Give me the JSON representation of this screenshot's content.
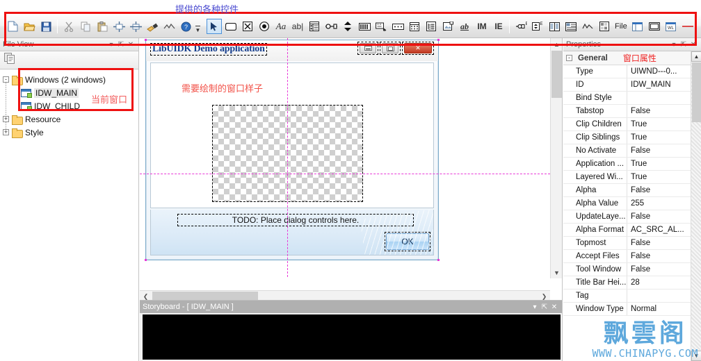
{
  "annotations": {
    "toolbar_note": "提供的各种控件",
    "window_note": "当前窗口",
    "canvas_note": "需要绘制的窗口样子",
    "properties_note": "窗口属性",
    "accent_red": "#ee1111",
    "accent_blue": "#4b4bd0"
  },
  "toolbar": {
    "groups": [
      {
        "name": "standard",
        "items": [
          {
            "icon": "new-file-icon",
            "label": "New"
          },
          {
            "icon": "open-folder-icon",
            "label": "Open"
          },
          {
            "icon": "save-disk-icon",
            "label": "Save"
          },
          {
            "icon": "cut-scissors-icon",
            "label": "Cut"
          },
          {
            "icon": "copy-icon",
            "label": "Copy"
          },
          {
            "icon": "paste-icon",
            "label": "Paste"
          },
          {
            "icon": "align-horizontal-icon",
            "label": "Align Horizontal"
          },
          {
            "icon": "align-vertical-icon",
            "label": "Align Vertical"
          },
          {
            "icon": "brush-icon",
            "label": "Brush"
          },
          {
            "icon": "curve-icon",
            "label": "Curve"
          },
          {
            "icon": "help-icon",
            "label": "Help"
          }
        ]
      },
      {
        "name": "controls",
        "items": [
          {
            "icon": "pointer-arrow-icon",
            "label": "Select",
            "selected": true
          },
          {
            "icon": "button-control-icon",
            "label": "Button"
          },
          {
            "icon": "checkbox-control-icon",
            "label": "Check Box"
          },
          {
            "icon": "radio-control-icon",
            "label": "Radio Button"
          },
          {
            "icon": "static-text-icon",
            "label": "Static Text"
          },
          {
            "icon": "edit-control-icon",
            "label": "Edit"
          },
          {
            "icon": "listview-control-icon",
            "label": "List View"
          },
          {
            "icon": "slider-control-icon",
            "label": "Slider"
          },
          {
            "icon": "spin-control-icon",
            "label": "Spin"
          },
          {
            "icon": "progress-control-icon",
            "label": "Progress"
          },
          {
            "icon": "hotkey-control-icon",
            "label": "Hot Key"
          },
          {
            "icon": "ip-address-icon",
            "label": "IP Address"
          },
          {
            "icon": "calendar-control-icon",
            "label": "Calendar"
          },
          {
            "icon": "treeview-control-icon",
            "label": "Tree View"
          },
          {
            "icon": "picture-control-icon",
            "label": "Picture"
          },
          {
            "icon": "ab-link-icon",
            "label": "ab"
          },
          {
            "icon": "im-icon",
            "label": "IM"
          },
          {
            "icon": "ie-icon",
            "label": "IE"
          },
          {
            "icon": "hotkey-ex-icon",
            "label": "Hot Key Ex"
          },
          {
            "icon": "spin-ex-icon",
            "label": "Spin Ex"
          },
          {
            "icon": "split-pane-icon",
            "label": "Split Pane"
          },
          {
            "icon": "report-list-icon",
            "label": "Report List"
          },
          {
            "icon": "chart-line-icon",
            "label": "Chart"
          },
          {
            "icon": "color-picker-icon",
            "label": "Color Picker"
          },
          {
            "icon": "file-label",
            "label": "File"
          },
          {
            "icon": "layout-left-icon",
            "label": "Layout Left"
          },
          {
            "icon": "panel-icon",
            "label": "Panel"
          },
          {
            "icon": "window-list-icon",
            "label": "Window List"
          },
          {
            "icon": "separator-line-icon",
            "label": "Separator"
          },
          {
            "icon": "text-tool-icon",
            "label": "Text"
          },
          {
            "icon": "window-tool-icon",
            "label": "Window"
          }
        ]
      },
      {
        "name": "extra",
        "items": [
          {
            "icon": "add-object-icon",
            "label": "Add Object"
          }
        ]
      }
    ]
  },
  "fileview": {
    "title": "File View",
    "caption_buttons": [
      "chevron-down-icon",
      "pin-icon",
      "close-icon"
    ],
    "toolbar_icon": "copy-pages-icon",
    "tree": {
      "root": {
        "label": "Windows (2 windows)",
        "expanded": true,
        "toggle": "-"
      },
      "children": [
        {
          "label": "IDW_MAIN",
          "icon": "window-node-icon",
          "selected": true
        },
        {
          "label": "IDW_CHILD",
          "icon": "window-node-icon",
          "selected": false
        }
      ],
      "siblings": [
        {
          "label": "Resource",
          "expanded": false,
          "toggle": "+"
        },
        {
          "label": "Style",
          "expanded": false,
          "toggle": "+"
        }
      ]
    }
  },
  "designer": {
    "window_title": "LibUIDK Demo application",
    "sys_buttons": [
      {
        "name": "minimize-button",
        "glyph": "▭"
      },
      {
        "name": "maximize-button",
        "glyph": "❐"
      },
      {
        "name": "close-button",
        "glyph": "✕"
      }
    ],
    "todo_text": "TODO: Place dialog controls here.",
    "ok_button": "OK"
  },
  "storyboard": {
    "title": "Storyboard - [ IDW_MAIN ]",
    "caption_buttons": [
      "chevron-down-icon",
      "pin-icon",
      "close-icon"
    ]
  },
  "properties": {
    "title": "Properties",
    "caption_buttons": [
      "chevron-down-icon",
      "pin-icon",
      "close-icon"
    ],
    "group": "General",
    "rows": [
      {
        "name": "Type",
        "value": "UIWND---0..."
      },
      {
        "name": "ID",
        "value": "IDW_MAIN"
      },
      {
        "name": "Bind Style",
        "value": ""
      },
      {
        "name": "Tabstop",
        "value": "False"
      },
      {
        "name": "Clip Children",
        "value": "True"
      },
      {
        "name": "Clip Siblings",
        "value": "True"
      },
      {
        "name": "No Activate",
        "value": "False"
      },
      {
        "name": "Application ...",
        "value": "True"
      },
      {
        "name": "Layered Wi...",
        "value": "True"
      },
      {
        "name": "Alpha",
        "value": "False"
      },
      {
        "name": "Alpha Value",
        "value": "255"
      },
      {
        "name": "UpdateLaye...",
        "value": "False"
      },
      {
        "name": "Alpha Format",
        "value": "AC_SRC_AL..."
      },
      {
        "name": "Topmost",
        "value": "False"
      },
      {
        "name": "Accept Files",
        "value": "False"
      },
      {
        "name": "Tool Window",
        "value": "False"
      },
      {
        "name": "Title Bar Hei...",
        "value": "28"
      },
      {
        "name": "Tag",
        "value": ""
      },
      {
        "name": "Window Type",
        "value": "Normal"
      }
    ]
  },
  "watermark": {
    "chinese": "飘雲阁",
    "url": "WWW.CHINAPYG.COM"
  }
}
